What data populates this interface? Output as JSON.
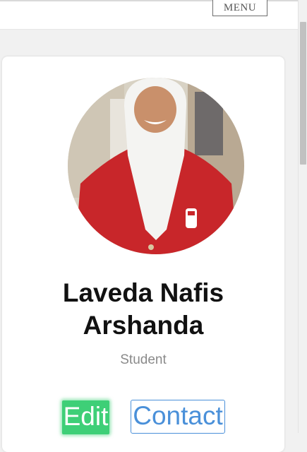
{
  "header": {
    "menu_label": "MENU"
  },
  "profile": {
    "avatar_icon": "student-photo",
    "name": "Laveda Nafis Arshanda",
    "role": "Student"
  },
  "actions": {
    "edit_label": "Edit",
    "contact_label": "Contact"
  },
  "colors": {
    "edit_button": "#3ecf77",
    "contact_border": "#4a90d9",
    "jacket": "#c8262a"
  }
}
